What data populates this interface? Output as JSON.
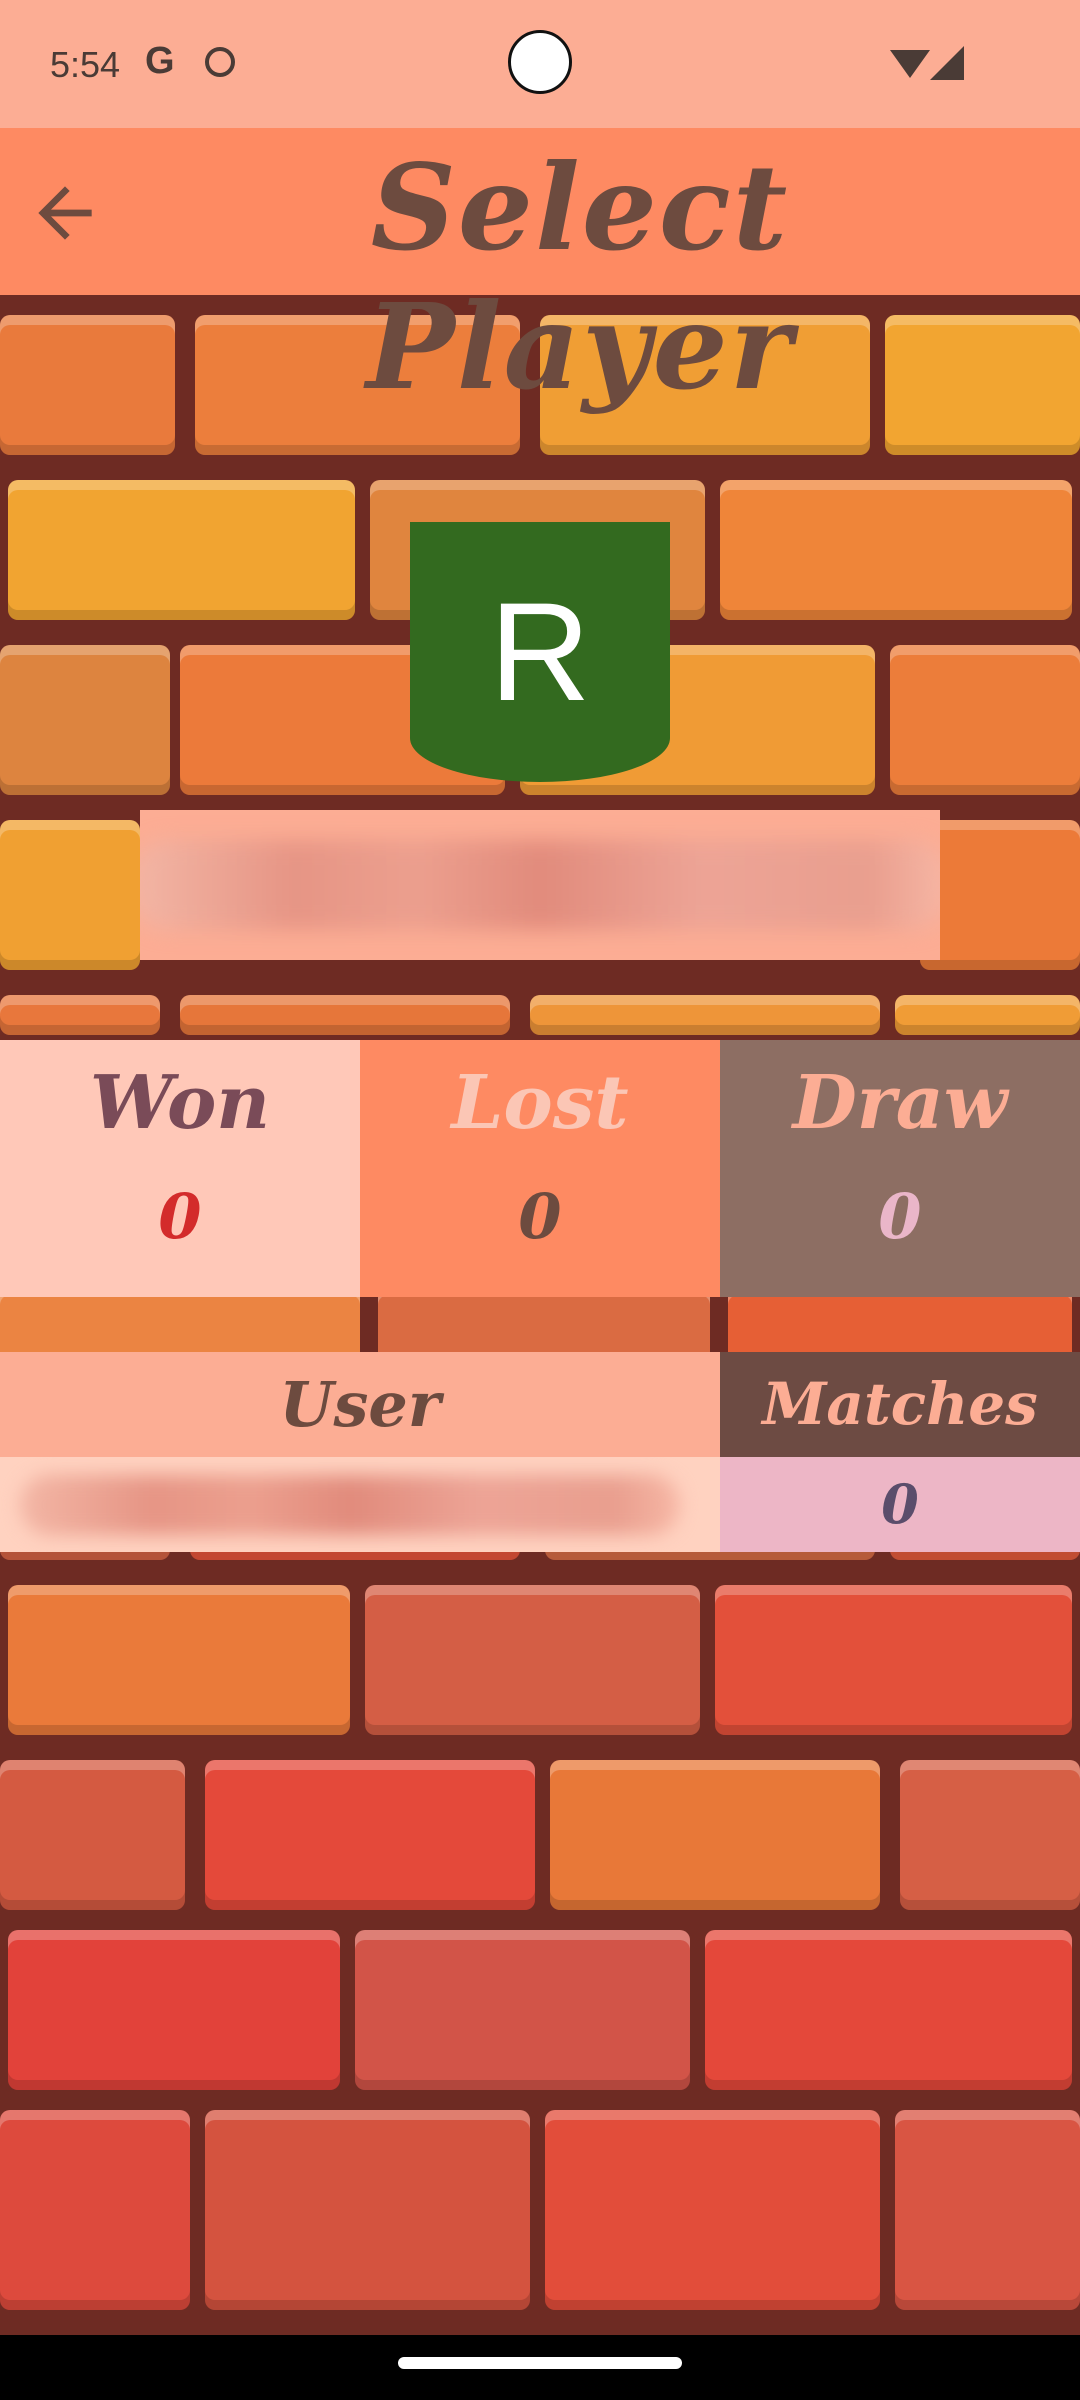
{
  "status_bar": {
    "time": "5:54",
    "icons": [
      "google-icon",
      "cat-icon",
      "wifi-icon",
      "cellular-icon"
    ]
  },
  "app_bar": {
    "title": "Select Player",
    "back_icon": "arrow-left-icon"
  },
  "player": {
    "avatar_letter": "R",
    "avatar_color": "#336a1f"
  },
  "stats": {
    "won": {
      "label": "Won",
      "value": "0"
    },
    "lost": {
      "label": "Lost",
      "value": "0"
    },
    "draw": {
      "label": "Draw",
      "value": "0"
    }
  },
  "table": {
    "headers": {
      "user": "User",
      "matches": "Matches"
    },
    "rows": [
      {
        "matches": "0"
      }
    ]
  },
  "colors": {
    "status_bar": "#fcad94",
    "app_bar": "#fe8a62",
    "title_text": "#6d4b3f"
  }
}
